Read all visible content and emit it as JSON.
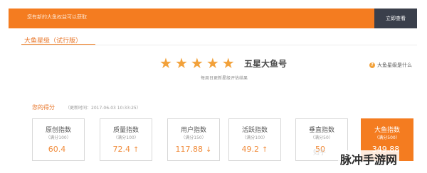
{
  "banner": {
    "text": "您有新的大鱼权益可以获取",
    "button": "立即查看"
  },
  "tab": {
    "label": "大鱼星级（试行版）"
  },
  "rating": {
    "stars": 5,
    "title": "五星大鱼号",
    "subtitle": "每周日更新星级评估结果"
  },
  "help": {
    "label": "大鱼星级是什么"
  },
  "score": {
    "heading": "您的得分",
    "time": "（更新时间：2017-06-03 10:33:25）"
  },
  "cards": [
    {
      "name": "原创指数",
      "cap": "（满分100）",
      "value": "60.4",
      "arrow": ""
    },
    {
      "name": "质量指数",
      "cap": "（满分100）",
      "value": "72.4",
      "arrow": "↑"
    },
    {
      "name": "用户指数",
      "cap": "（满分150）",
      "value": "117.88",
      "arrow": "↓"
    },
    {
      "name": "活跃指数",
      "cap": "（满分100）",
      "value": "49.2",
      "arrow": "↑"
    },
    {
      "name": "垂直指数",
      "cap": "（满分50）",
      "value": "50",
      "arrow": ""
    },
    {
      "name": "大鱼指数",
      "cap": "（满分500）",
      "value": "349.88",
      "arrow": ""
    }
  ],
  "watermark": "知乎",
  "brand": "脉冲手游网",
  "colors": {
    "accent": "#f47c20",
    "star": "#f2a13a",
    "dark_button": "#3a3f4b"
  }
}
